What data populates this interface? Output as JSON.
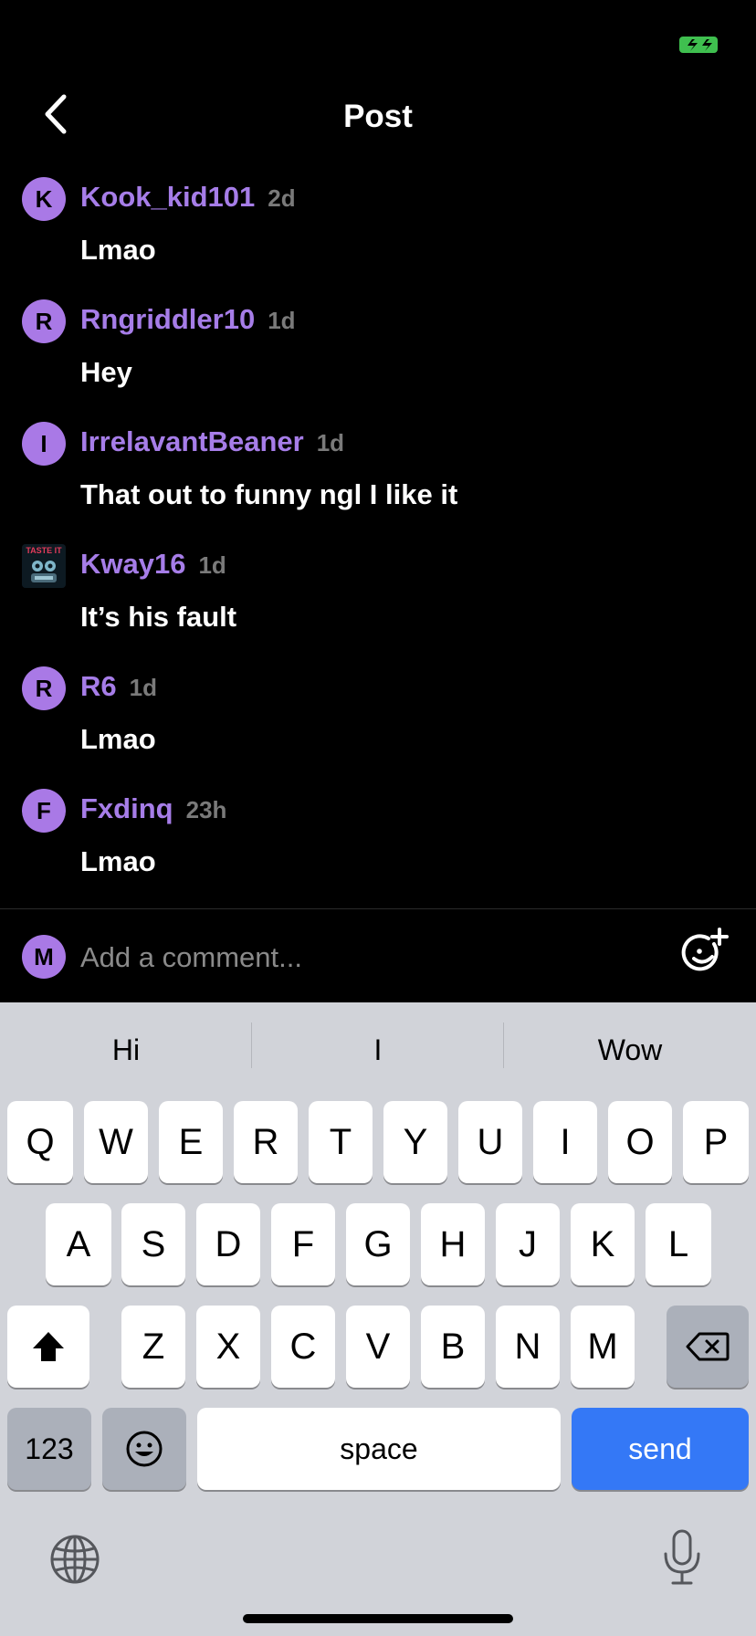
{
  "header": {
    "title": "Post"
  },
  "comments": [
    {
      "initial": "K",
      "username": "Kook_kid101",
      "time": "2d",
      "text": "Lmao"
    },
    {
      "initial": "R",
      "username": "Rngriddler10",
      "time": "1d",
      "text": "Hey"
    },
    {
      "initial": "I",
      "username": "IrrelavantBeaner",
      "time": "1d",
      "text": "That out to funny ngl I like it"
    },
    {
      "initial": "",
      "username": "Kway16",
      "time": "1d",
      "text": "It’s his fault",
      "avatar_image_caption": "TASTE IT"
    },
    {
      "initial": "R",
      "username": "R6",
      "time": "1d",
      "text": "Lmao"
    },
    {
      "initial": "F",
      "username": "Fxdinq",
      "time": "23h",
      "text": "Lmao"
    }
  ],
  "composer": {
    "initial": "M",
    "placeholder": "Add a comment..."
  },
  "keyboard": {
    "suggestions": [
      "Hi",
      "I",
      "Wow"
    ],
    "row1": [
      "Q",
      "W",
      "E",
      "R",
      "T",
      "Y",
      "U",
      "I",
      "O",
      "P"
    ],
    "row2": [
      "A",
      "S",
      "D",
      "F",
      "G",
      "H",
      "J",
      "K",
      "L"
    ],
    "row3": [
      "Z",
      "X",
      "C",
      "V",
      "B",
      "N",
      "M"
    ],
    "numbers_label": "123",
    "space_label": "space",
    "send_label": "send"
  },
  "colors": {
    "accent": "#a67de8",
    "send": "#3478f6",
    "battery": "#3fbf4f"
  }
}
